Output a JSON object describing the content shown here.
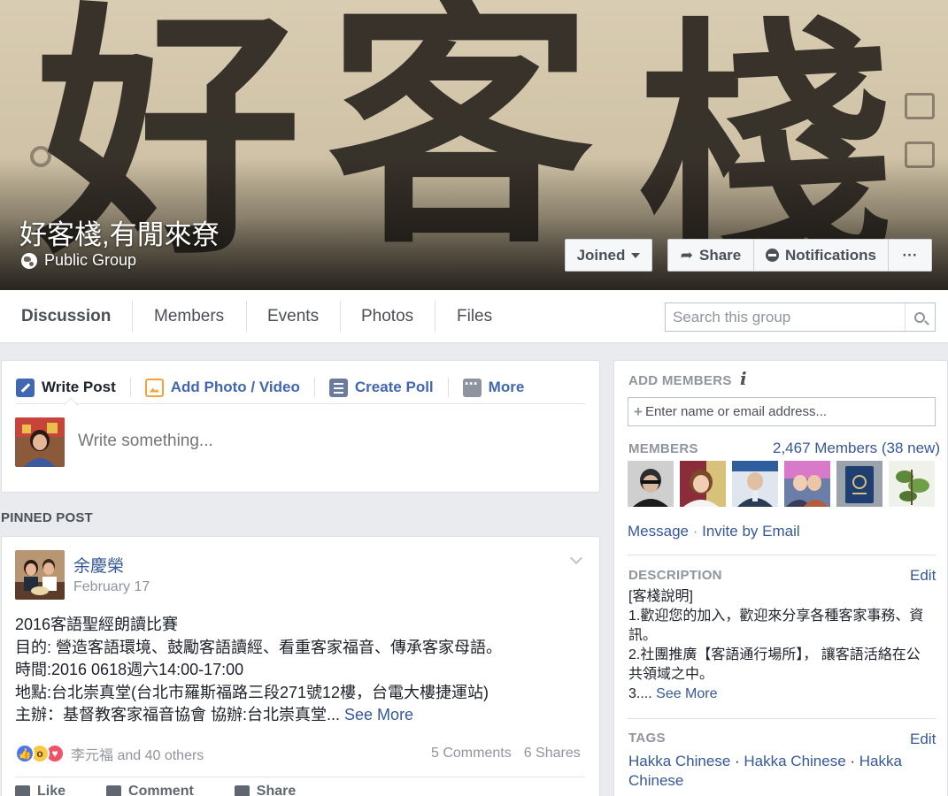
{
  "cover": {
    "calligraphy": [
      "好",
      "客",
      "棧"
    ],
    "group_title": "好客棧,有閒來尞",
    "privacy_label": "Public Group"
  },
  "header_buttons": {
    "joined": "Joined",
    "share": "Share",
    "notifications": "Notifications",
    "more": "···"
  },
  "tabs": [
    "Discussion",
    "Members",
    "Events",
    "Photos",
    "Files"
  ],
  "search": {
    "placeholder": "Search this group"
  },
  "composer": {
    "tabs": [
      "Write Post",
      "Add Photo / Video",
      "Create Poll",
      "More"
    ],
    "placeholder": "Write something..."
  },
  "pinned_label": "PINNED POST",
  "post": {
    "author": "余慶榮",
    "date": "February 17",
    "lines": [
      "2016客語聖經朗讀比賽",
      "目的: 營造客語環境、鼓勵客語讀經、看重客家福音、傳承客家母語。",
      "時間:2016 0618週六14:00-17:00",
      "地點:台北崇真堂(台北市羅斯福路三段271號12樓，台電大樓捷運站)",
      "主辦：基督教客家福音協會 協辦:台北崇真堂..."
    ],
    "see_more": "See More",
    "reactions_text": "李元福 and 40 others",
    "comments": "5 Comments",
    "shares": "6 Shares",
    "actions": [
      "Like",
      "Comment",
      "Share"
    ]
  },
  "sidebar": {
    "add_members_heading": "ADD MEMBERS",
    "add_members_placeholder": "Enter name or email address...",
    "members_heading": "MEMBERS",
    "members_count": "2,467 Members (38 new)",
    "message_link": "Message",
    "link_separator": " · ",
    "invite_link": "Invite by Email",
    "description_heading": "DESCRIPTION",
    "edit_label": "Edit",
    "description_lines": [
      "[客棧說明]",
      "1.歡迎您的加入，歡迎來分享各種客家事務、資訊。",
      "2.社團推廣【客語通行場所】， 讓客語活絡在公共領域之中。",
      "3...."
    ],
    "description_see_more": "See More",
    "tags_heading": "TAGS",
    "tags": [
      "Hakka Chinese",
      "Hakka Chinese",
      "Hakka Chinese"
    ]
  }
}
